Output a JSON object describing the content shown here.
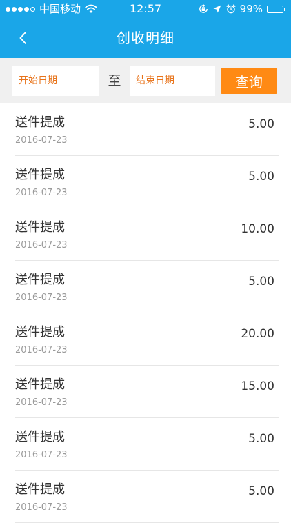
{
  "status_bar": {
    "carrier": "中国移动",
    "time": "12:57",
    "battery": "99%",
    "battery_level": 0.99,
    "signal_bars": 4,
    "signal_total": 5,
    "icons": [
      "signal-icon",
      "wifi-icon",
      "orientation-lock-icon",
      "location-icon",
      "alarm-icon",
      "battery-icon"
    ]
  },
  "header": {
    "title": "创收明细",
    "back_icon": "chevron-left-icon",
    "background_color": "#1aa6e8"
  },
  "filter": {
    "start_placeholder": "开始日期",
    "to_label": "至",
    "end_placeholder": "结束日期",
    "query_label": "查询",
    "accent_color": "#ff8a14"
  },
  "records": [
    {
      "type": "送件提成",
      "date": "2016-07-23",
      "amount": "5.00"
    },
    {
      "type": "送件提成",
      "date": "2016-07-23",
      "amount": "5.00"
    },
    {
      "type": "送件提成",
      "date": "2016-07-23",
      "amount": "10.00"
    },
    {
      "type": "送件提成",
      "date": "2016-07-23",
      "amount": "5.00"
    },
    {
      "type": "送件提成",
      "date": "2016-07-23",
      "amount": "20.00"
    },
    {
      "type": "送件提成",
      "date": "2016-07-23",
      "amount": "15.00"
    },
    {
      "type": "送件提成",
      "date": "2016-07-23",
      "amount": "5.00"
    },
    {
      "type": "送件提成",
      "date": "2016-07-23",
      "amount": "5.00"
    }
  ]
}
